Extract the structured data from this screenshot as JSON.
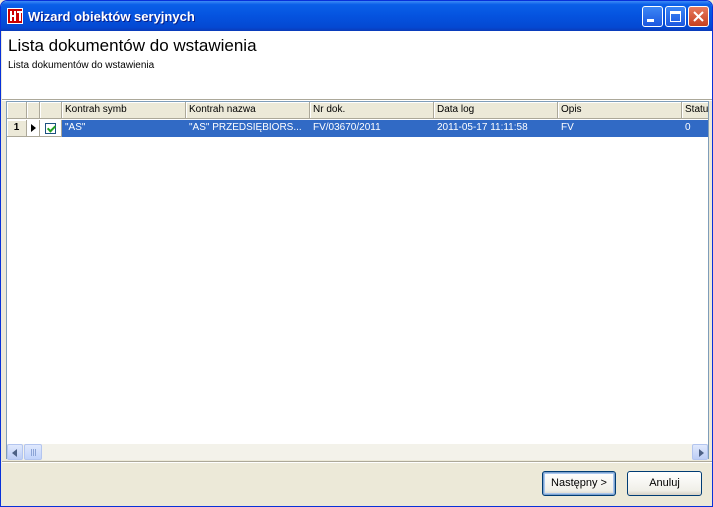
{
  "window": {
    "title": "Wizard obiektów seryjnych"
  },
  "header": {
    "title": "Lista dokumentów do wstawienia",
    "subtitle": "Lista dokumentów do wstawienia"
  },
  "grid": {
    "columns": [
      "Kontrah symb",
      "Kontrah nazwa",
      "Nr dok.",
      "Data log",
      "Opis",
      "Statu"
    ],
    "rows": [
      {
        "index": "1",
        "checked": true,
        "kontrah_symb": "\"AS\"",
        "kontrah_nazwa": "\"AS\" PRZEDSIĘBIORS...",
        "nr_dok": "FV/03670/2011",
        "data_log": "2011-05-17 11:11:58",
        "opis": "FV",
        "status": "0"
      }
    ]
  },
  "buttons": {
    "next_label": "Następny >",
    "cancel_label": "Anuluj"
  }
}
